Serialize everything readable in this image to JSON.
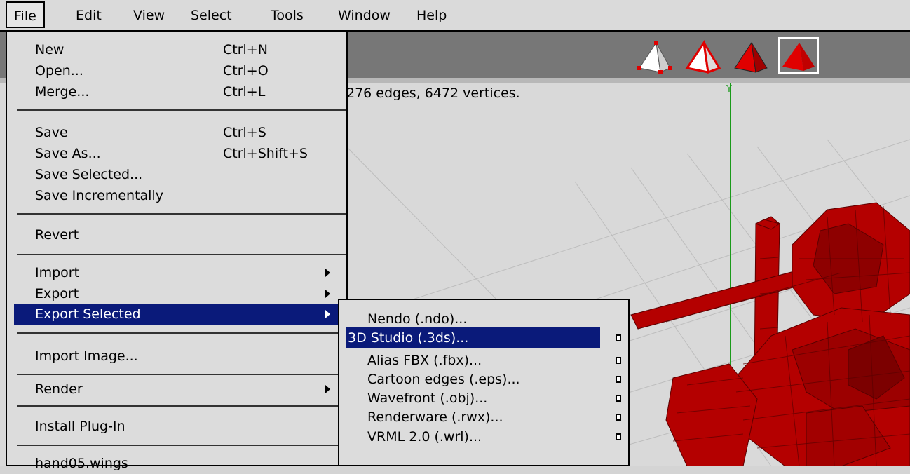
{
  "menubar": {
    "items": [
      "File",
      "Edit",
      "View",
      "Select",
      "Tools",
      "Window",
      "Help"
    ]
  },
  "viewport": {
    "info_text": "276 edges, 6472 vertices.",
    "axis_label": "Y"
  },
  "selection_modes": [
    "vertex-select-icon",
    "edge-select-icon",
    "face-select-icon",
    "body-select-icon"
  ],
  "file_menu": {
    "items": [
      {
        "label": "New",
        "shortcut": "Ctrl+N"
      },
      {
        "label": "Open...",
        "shortcut": "Ctrl+O"
      },
      {
        "label": "Merge...",
        "shortcut": "Ctrl+L"
      },
      {
        "label": "Save",
        "shortcut": "Ctrl+S"
      },
      {
        "label": "Save As...",
        "shortcut": "Ctrl+Shift+S"
      },
      {
        "label": "Save Selected...",
        "shortcut": ""
      },
      {
        "label": "Save Incrementally",
        "shortcut": ""
      },
      {
        "label": "Revert",
        "shortcut": ""
      },
      {
        "label": "Import",
        "shortcut": ""
      },
      {
        "label": "Export",
        "shortcut": ""
      },
      {
        "label": "Export Selected",
        "shortcut": ""
      },
      {
        "label": "Import Image...",
        "shortcut": ""
      },
      {
        "label": "Render",
        "shortcut": ""
      },
      {
        "label": "Install Plug-In",
        "shortcut": ""
      },
      {
        "label": "hand05.wings",
        "shortcut": ""
      }
    ]
  },
  "export_submenu": {
    "items": [
      {
        "label": "Nendo (.ndo)..."
      },
      {
        "label": "3D Studio (.3ds)..."
      },
      {
        "label": "Alias FBX (.fbx)..."
      },
      {
        "label": "Cartoon edges (.eps)..."
      },
      {
        "label": "Wavefront (.obj)..."
      },
      {
        "label": "Renderware (.rwx)..."
      },
      {
        "label": "VRML 2.0 (.wrl)..."
      }
    ]
  },
  "colors": {
    "menu_highlight": "#0a1a7a",
    "model_red": "#b40000",
    "axis_green": "#1a9a1a"
  }
}
